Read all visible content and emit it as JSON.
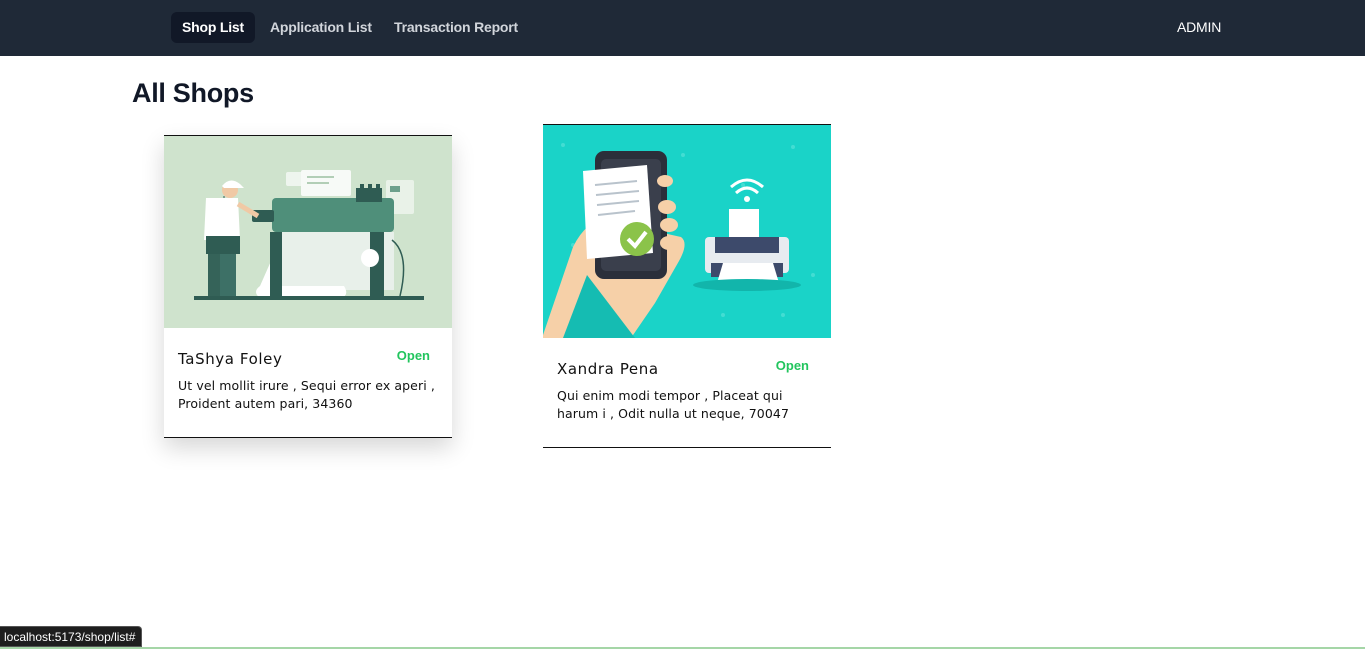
{
  "nav": {
    "items": [
      {
        "label": "Shop List"
      },
      {
        "label": "Application List"
      },
      {
        "label": "Transaction Report"
      }
    ],
    "user": "ADMIN"
  },
  "page": {
    "title": "All Shops"
  },
  "shops": [
    {
      "name": "TaShya Foley",
      "status": "Open",
      "address": "Ut vel mollit irure , Sequi error ex aperi , Proident autem pari, 34360",
      "image": "printer-operator-illustration"
    },
    {
      "name": "Xandra Pena",
      "status": "Open",
      "address": "Qui enim modi tempor , Placeat qui harum i , Odit nulla ut neque, 70047",
      "image": "mobile-print-illustration"
    }
  ],
  "statusbar": {
    "url": "localhost:5173/shop/list#"
  },
  "colors": {
    "navbar": "#1f2937",
    "active_nav": "#111827",
    "status_open": "#22c55e",
    "teal": "#1ad3c8"
  }
}
